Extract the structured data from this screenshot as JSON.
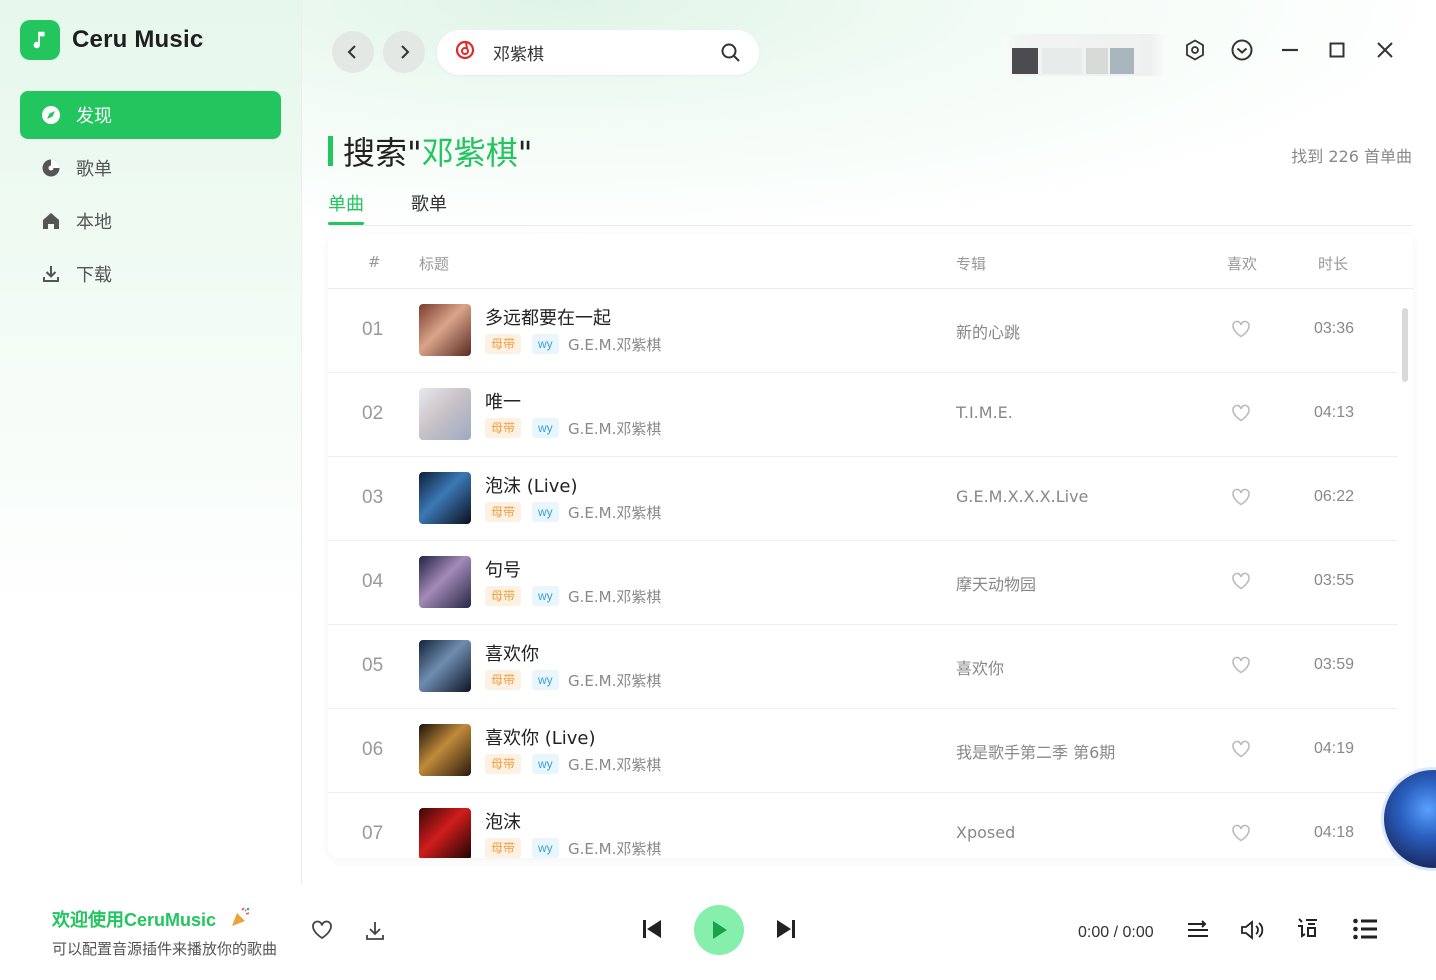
{
  "app": {
    "name": "Ceru Music"
  },
  "sidebar": {
    "items": [
      {
        "label": "发现",
        "icon": "compass-icon",
        "active": true
      },
      {
        "label": "歌单",
        "icon": "playlist-disc-icon",
        "active": false
      },
      {
        "label": "本地",
        "icon": "home-icon",
        "active": false
      },
      {
        "label": "下载",
        "icon": "download-icon",
        "active": false
      }
    ]
  },
  "search": {
    "value": "邓紫棋",
    "source_icon": "netease-icon"
  },
  "heading": {
    "prefix": "搜索\"",
    "keyword": "邓紫棋",
    "suffix": "\""
  },
  "result_count": "找到 226 首单曲",
  "tabs": [
    {
      "label": "单曲",
      "active": true
    },
    {
      "label": "歌单",
      "active": false
    }
  ],
  "table": {
    "headers": {
      "index": "#",
      "title": "标题",
      "album": "专辑",
      "like": "喜欢",
      "duration": "时长"
    },
    "rows": [
      {
        "num": "01",
        "title": "多远都要在一起",
        "tag1": "母带",
        "tag2": "wy",
        "artist": "G.E.M.邓紫棋",
        "album": "新的心跳",
        "duration": "03:36"
      },
      {
        "num": "02",
        "title": "唯一",
        "tag1": "母带",
        "tag2": "wy",
        "artist": "G.E.M.邓紫棋",
        "album": "T.I.M.E.",
        "duration": "04:13"
      },
      {
        "num": "03",
        "title": "泡沫 (Live)",
        "tag1": "母带",
        "tag2": "wy",
        "artist": "G.E.M.邓紫棋",
        "album": "G.E.M.X.X.X.Live",
        "duration": "06:22"
      },
      {
        "num": "04",
        "title": "句号",
        "tag1": "母带",
        "tag2": "wy",
        "artist": "G.E.M.邓紫棋",
        "album": "摩天动物园",
        "duration": "03:55"
      },
      {
        "num": "05",
        "title": "喜欢你",
        "tag1": "母带",
        "tag2": "wy",
        "artist": "G.E.M.邓紫棋",
        "album": "喜欢你",
        "duration": "03:59"
      },
      {
        "num": "06",
        "title": "喜欢你 (Live)",
        "tag1": "母带",
        "tag2": "wy",
        "artist": "G.E.M.邓紫棋",
        "album": "我是歌手第二季 第6期",
        "duration": "04:19"
      },
      {
        "num": "07",
        "title": "泡沫",
        "tag1": "母带",
        "tag2": "wy",
        "artist": "G.E.M.邓紫棋",
        "album": "Xposed",
        "duration": "04:18"
      }
    ]
  },
  "player": {
    "title": "欢迎使用CeruMusic",
    "subtitle": "可以配置音源插件来播放你的歌曲",
    "time": "0:00 / 0:00"
  },
  "colors": {
    "accent": "#22c55e",
    "play_button": "#86efac"
  }
}
